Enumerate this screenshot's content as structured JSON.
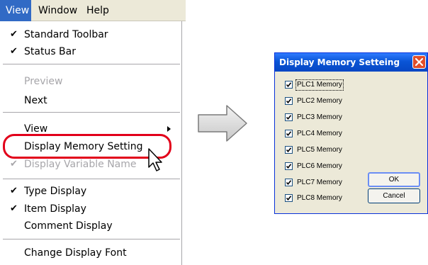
{
  "menubar": {
    "items": [
      "View",
      "Window",
      "Help"
    ]
  },
  "menu": {
    "items": [
      {
        "label": "Standard Toolbar",
        "checked": true,
        "disabled": false
      },
      {
        "label": "Status Bar",
        "checked": true,
        "disabled": false
      },
      {
        "label": "Preview",
        "checked": false,
        "disabled": true
      },
      {
        "label": "Next",
        "checked": false,
        "disabled": false
      },
      {
        "label": "View",
        "checked": false,
        "disabled": false,
        "submenu": true
      },
      {
        "label": "Display Memory Setting",
        "checked": false,
        "disabled": false
      },
      {
        "label": "Display Variable Name",
        "checked": true,
        "disabled": true
      },
      {
        "label": "Type Display",
        "checked": true,
        "disabled": false
      },
      {
        "label": "Item Display",
        "checked": true,
        "disabled": false
      },
      {
        "label": "Comment Display",
        "checked": false,
        "disabled": false
      },
      {
        "label": "Change Display Font",
        "checked": false,
        "disabled": false
      }
    ],
    "check_glyph": "✔"
  },
  "dialog": {
    "title": "Display Memory Setteing",
    "checkboxes": [
      {
        "label": "PLC1 Memory",
        "checked": true
      },
      {
        "label": "PLC2 Memory",
        "checked": true
      },
      {
        "label": "PLC3 Memory",
        "checked": true
      },
      {
        "label": "PLC4 Memory",
        "checked": true
      },
      {
        "label": "PLC5 Memory",
        "checked": true
      },
      {
        "label": "PLC6 Memory",
        "checked": true
      },
      {
        "label": "PLC7 Memory",
        "checked": true
      },
      {
        "label": "PLC8 Memory",
        "checked": true
      }
    ],
    "ok_label": "OK",
    "cancel_label": "Cancel"
  },
  "colors": {
    "menu_highlight": "#316ac5",
    "ring": "#e2001a",
    "titlebar": "#0a55d6",
    "close_button": "#e14e2a"
  }
}
